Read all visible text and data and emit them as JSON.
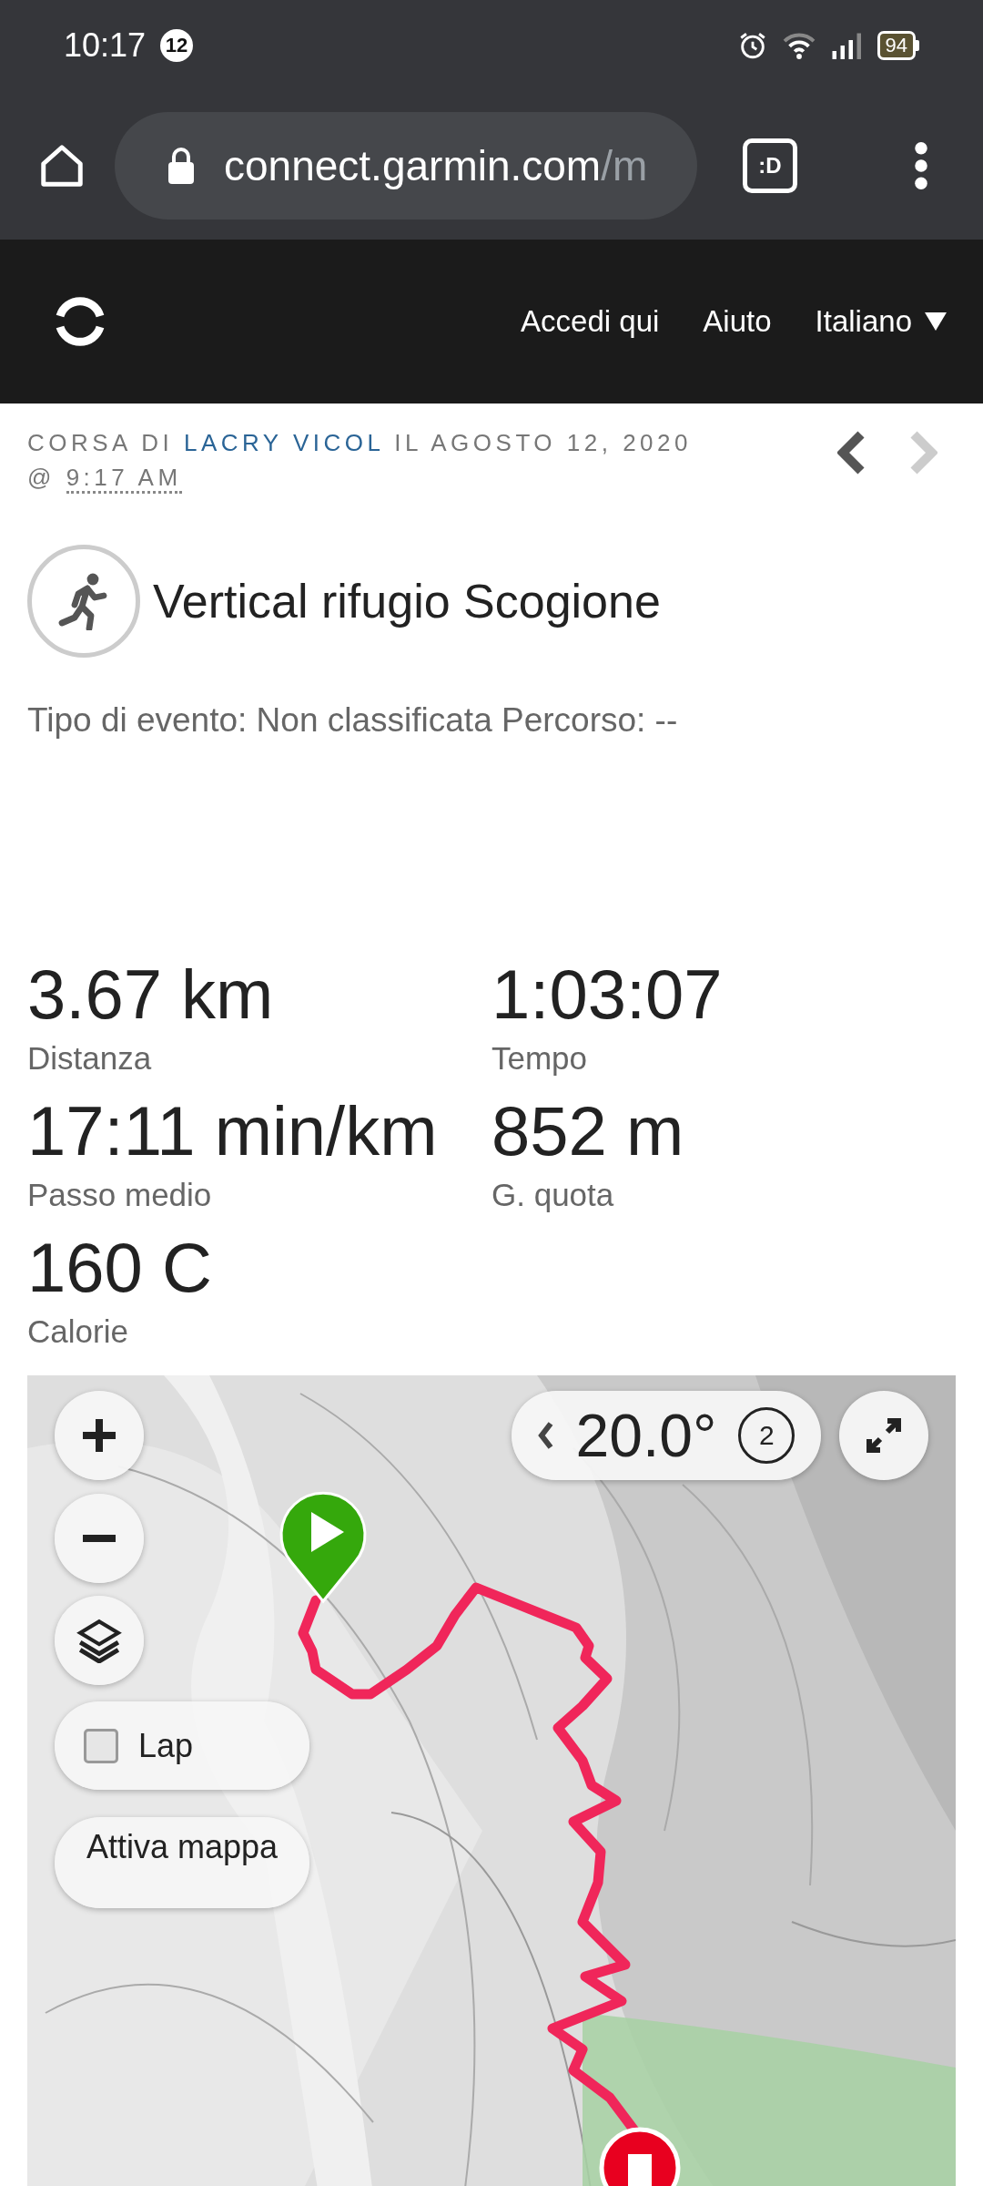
{
  "status_bar": {
    "time": "10:17",
    "notification_count": "12",
    "battery": "94"
  },
  "browser": {
    "url_host": "connect.garmin.com",
    "url_path": "/m",
    "tab_count": ":D"
  },
  "header": {
    "nav": [
      {
        "label": "Accedi qui",
        "kind": "link"
      },
      {
        "label": "Aiuto",
        "kind": "link"
      },
      {
        "label": "Italiano",
        "kind": "dropdown"
      }
    ]
  },
  "activity": {
    "byline_prefix": "CORSA DI",
    "author": "LACRY VICOL",
    "byline_date": "IL AGOSTO 12, 2020",
    "at": "@",
    "start_time": "9:17 AM",
    "prev": {
      "disabled": false
    },
    "next": {
      "disabled": true
    },
    "title": "Vertical rifugio Scogione",
    "details": "Tipo di evento: Non classificata Percorso: --"
  },
  "stats": [
    {
      "value": "3.67 km",
      "label": "Distanza"
    },
    {
      "value": "1:03:07",
      "label": "Tempo"
    },
    {
      "value": "17:11 min/km",
      "label": "Passo medio"
    },
    {
      "value": "852 m",
      "label": "G. quota"
    },
    {
      "value": "160 C",
      "label": "Calorie"
    }
  ],
  "map": {
    "kind": "picture",
    "rotation": "20.0°",
    "compass_value": "2",
    "lap": {
      "label": "Lap",
      "checked": false
    },
    "activate_label": "Attiva mappa"
  }
}
